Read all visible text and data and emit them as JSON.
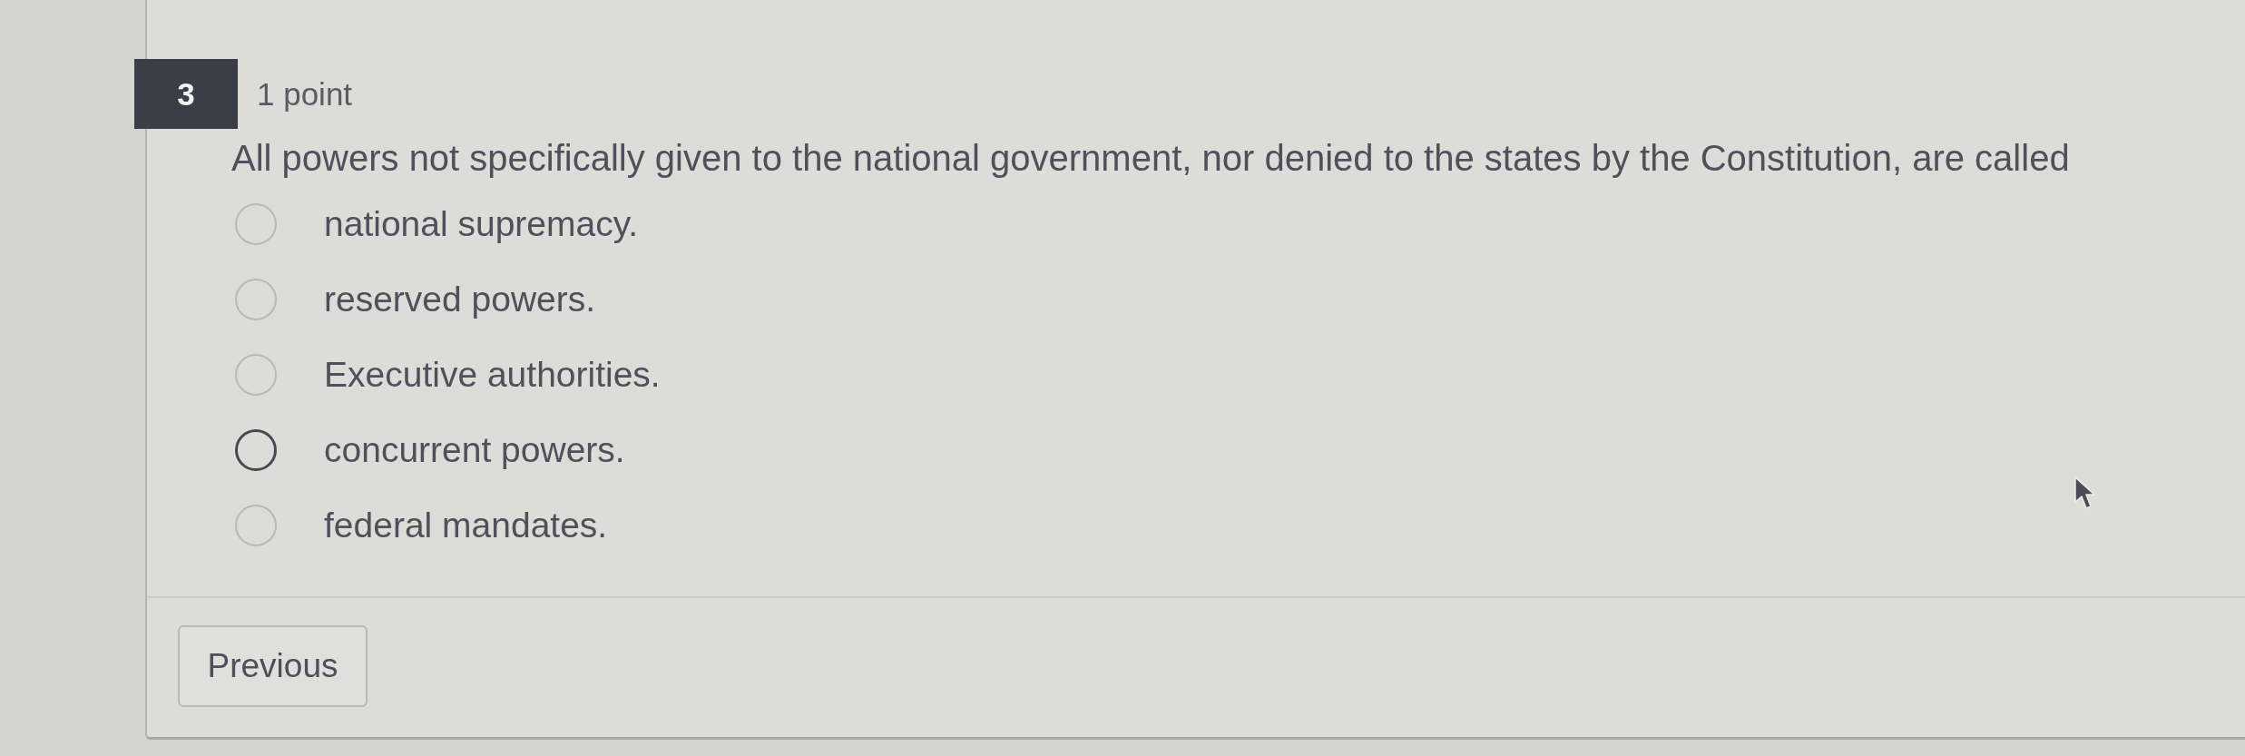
{
  "question": {
    "number": "3",
    "points": "1 point",
    "text": "All powers not specifically given to the national government, nor denied to the states by the Constitution, are called"
  },
  "options": [
    {
      "label": "national supremacy.",
      "selected": false,
      "focused": false
    },
    {
      "label": "reserved powers.",
      "selected": false,
      "focused": false
    },
    {
      "label": "Executive authorities.",
      "selected": false,
      "focused": false
    },
    {
      "label": "concurrent powers.",
      "selected": false,
      "focused": true
    },
    {
      "label": "federal mandates.",
      "selected": false,
      "focused": false
    }
  ],
  "navigation": {
    "previous": "Previous"
  }
}
